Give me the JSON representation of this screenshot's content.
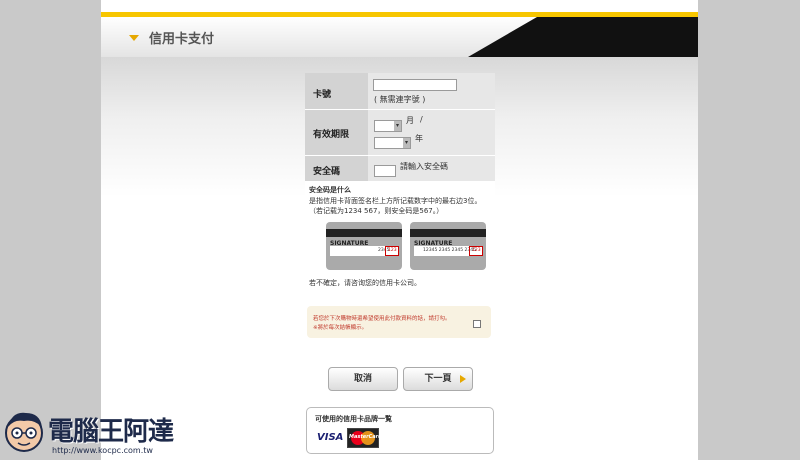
{
  "header": {
    "title": "信用卡支付"
  },
  "form": {
    "card_number": {
      "label": "卡號",
      "value": "",
      "hint": "( 無需連字號 )"
    },
    "expiry": {
      "label": "有效期限",
      "month_suffix": "月",
      "slash": "/",
      "year_suffix": "年",
      "month_value": "",
      "year_value": ""
    },
    "cvv": {
      "label": "安全碼",
      "value": "",
      "hint": "請輸入安全碼"
    }
  },
  "cvv_help": {
    "title": "安全码是什么",
    "line1": "是指信用卡背面签名栏上方所记载数字中的最右边3位。",
    "line2": "（若记载为1234 567，则安全码是567。）",
    "card1": {
      "signature": "SIGNATURE",
      "number": "2345",
      "cvv": "123"
    },
    "card2": {
      "signature": "SIGNATURE",
      "number": "12345 2345 2345 2345",
      "cvv": "123"
    },
    "unsure": "若不確定，请咨询您的信用卡公司。"
  },
  "notice": {
    "line1": "若您於下次購物時還希望使用此付款資料的話，請打勾。",
    "line2": "※將於每次結帳顯示。"
  },
  "buttons": {
    "cancel": "取消",
    "next": "下一頁"
  },
  "brands": {
    "title": "可使用的信用卡品牌一覧",
    "visa": "VISA",
    "mastercard": "MasterCard"
  },
  "watermark": {
    "name": "電腦王阿達",
    "url": "http://www.kocpc.com.tw"
  },
  "colors": {
    "accent": "#f7c600",
    "header_black": "#111111",
    "notice_text": "#c0392b"
  }
}
